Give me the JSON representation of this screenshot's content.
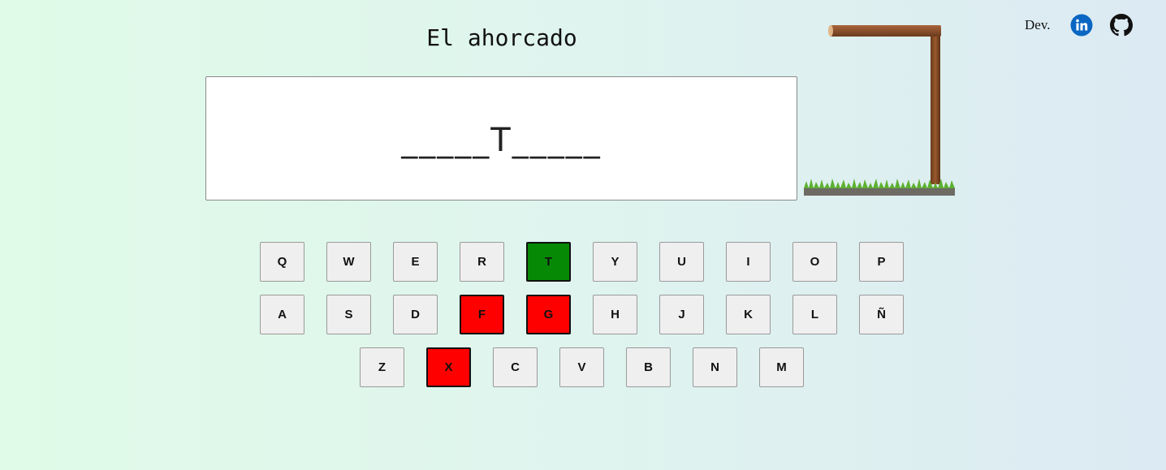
{
  "title": "El ahorcado",
  "word_display": "_____T_____",
  "header": {
    "dev_label": "Dev.",
    "links": [
      "linkedin-icon",
      "github-icon"
    ]
  },
  "colors": {
    "correct": "#068a06",
    "wrong": "#ff0000",
    "default_key": "#efefef",
    "linkedin": "#0a66c2"
  },
  "keyboard": {
    "rows": [
      [
        "Q",
        "W",
        "E",
        "R",
        "T",
        "Y",
        "U",
        "I",
        "O",
        "P"
      ],
      [
        "A",
        "S",
        "D",
        "F",
        "G",
        "H",
        "J",
        "K",
        "L",
        "Ñ"
      ],
      [
        "Z",
        "X",
        "C",
        "V",
        "B",
        "N",
        "M"
      ]
    ],
    "correct": [
      "T"
    ],
    "wrong": [
      "F",
      "G",
      "X"
    ]
  }
}
